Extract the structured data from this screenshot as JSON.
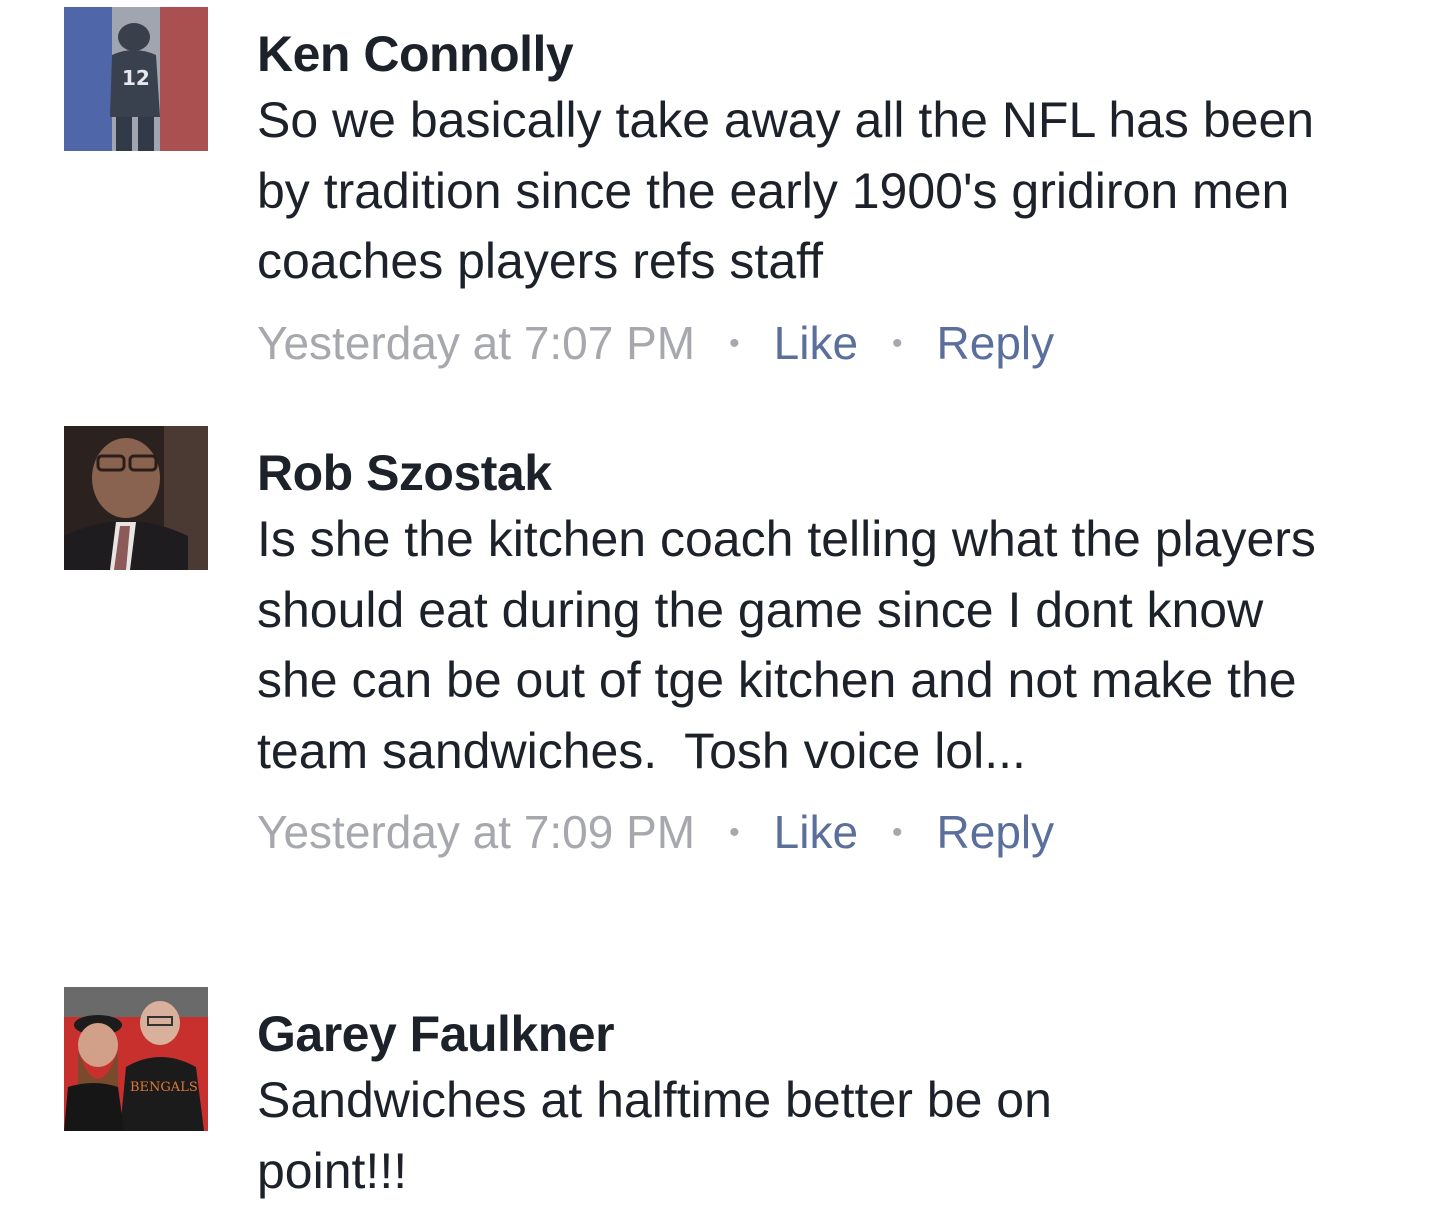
{
  "comments": [
    {
      "author": "Ken Connolly",
      "text": "So we basically take away all the NFL has been by tradition since the early 1900's gridiron men coaches players refs staff",
      "timestamp": "Yesterday at 7:07 PM",
      "like_label": "Like",
      "reply_label": "Reply",
      "separator": "•",
      "avatar_description": "football player number 12 with tricolor overlay"
    },
    {
      "author": "Rob Szostak",
      "text": "Is she the kitchen coach telling what the players should eat during the game since I dont know she can be out of tge kitchen and not make the team sandwiches.  Tosh voice lol...",
      "timestamp": "Yesterday at 7:09 PM",
      "like_label": "Like",
      "reply_label": "Reply",
      "separator": "•",
      "avatar_description": "man in suit and tie"
    },
    {
      "author": "Garey Faulkner",
      "text": "Sandwiches at halftime better be on point!!!",
      "avatar_description": "two men in Bengals hoodies on red carpet"
    }
  ],
  "colors": {
    "text": "#1d2129",
    "timestamp": "#a6a8ad",
    "action_link": "#5a6f9b",
    "background": "#ffffff"
  }
}
